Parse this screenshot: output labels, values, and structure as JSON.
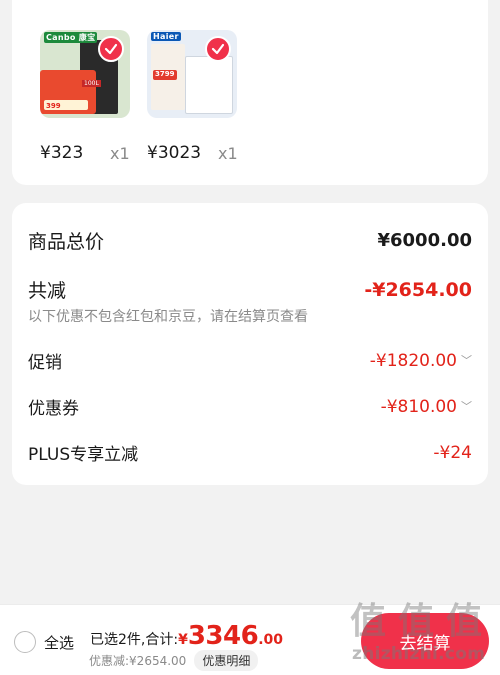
{
  "products": [
    {
      "brand_logo": "Canbo 康宝",
      "price": "¥323",
      "qty": "x1",
      "badges": [
        "399",
        "100L"
      ]
    },
    {
      "brand_logo": "Haier",
      "price": "¥3023",
      "qty": "x1",
      "badges": [
        "3799"
      ]
    }
  ],
  "summary": {
    "total_label": "商品总价",
    "total_value": "¥6000.00",
    "reduce_label": "共减",
    "reduce_value": "-¥2654.00",
    "note": "以下优惠不包含红包和京豆，请在结算页查看",
    "items": [
      {
        "label": "促销",
        "value": "-¥1820.00",
        "expandable": true
      },
      {
        "label": "优惠券",
        "value": "-¥810.00",
        "expandable": true
      },
      {
        "label": "PLUS专享立减",
        "value": "-¥24",
        "expandable": false
      }
    ]
  },
  "bottom_bar": {
    "select_all": "全选",
    "selected_text": "已选2件,合计:",
    "currency": "¥",
    "total_int": "3346",
    "total_dec": ".00",
    "discount_text": "优惠减:¥2654.00",
    "detail_button": "优惠明细",
    "checkout_button": "去结算"
  },
  "watermark": {
    "chars": "值值值",
    "url": "zhizhizhi.com"
  },
  "colors": {
    "accent_red": "#e2231a",
    "button_red": "#f0314a",
    "background": "#f2f2f2"
  },
  "icons": {
    "check": "check-circle-icon",
    "chevron": "chevron-down-icon",
    "radio": "radio-unchecked-icon"
  }
}
